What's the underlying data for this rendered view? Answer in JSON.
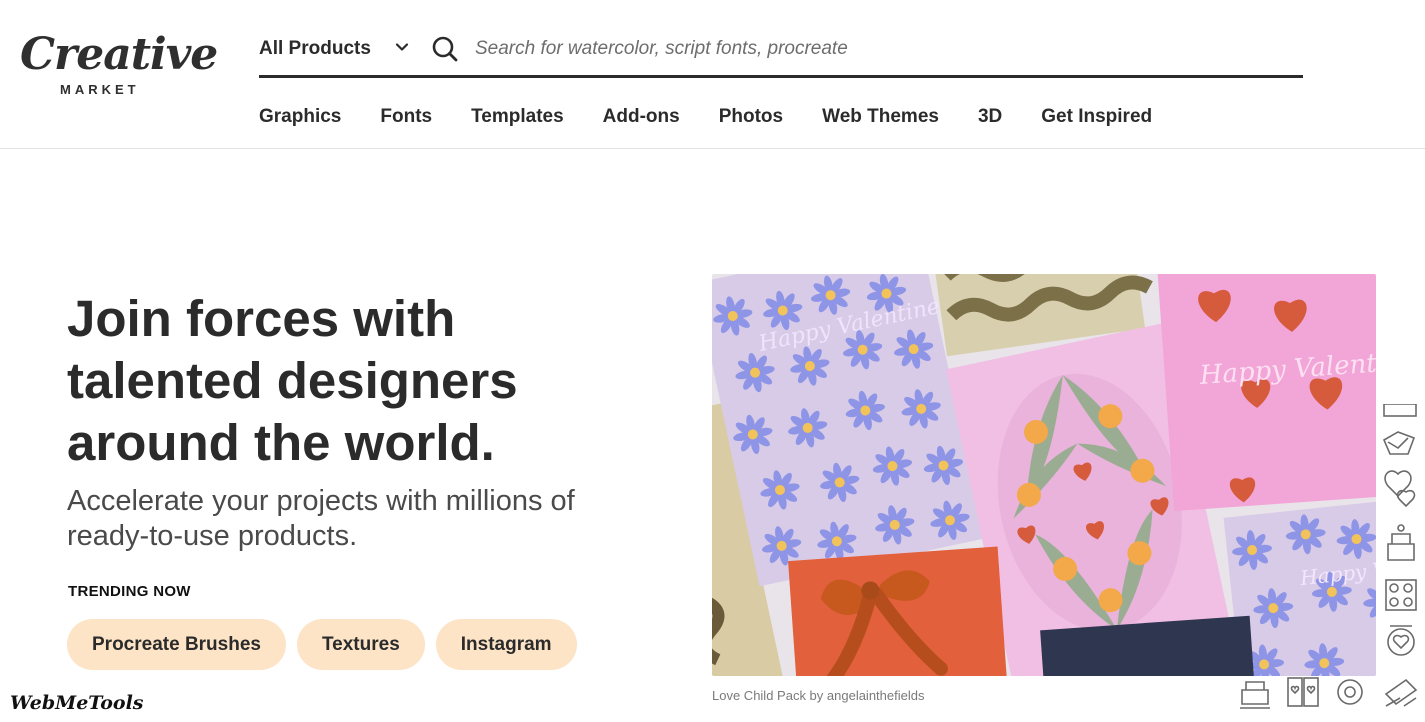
{
  "header": {
    "logo": {
      "script": "Creative",
      "sub": "MARKET"
    },
    "search": {
      "category_label": "All Products",
      "placeholder": "Search for watercolor, script fonts, procreate",
      "value": ""
    },
    "nav": [
      "Graphics",
      "Fonts",
      "Templates",
      "Add-ons",
      "Photos",
      "Web Themes",
      "3D",
      "Get Inspired"
    ]
  },
  "hero": {
    "title": "Join forces with talented designers around the world.",
    "subtitle": "Accelerate your projects with millions of ready-to-use products.",
    "trending_label": "TRENDING NOW",
    "trending": [
      "Procreate Brushes",
      "Textures",
      "Instagram"
    ],
    "image_caption": "Love Child Pack by angelainthefields",
    "card_texts": {
      "happy_valentines": "Happy Valentines"
    }
  },
  "watermark": "WebMeTools",
  "colors": {
    "pill_bg": "#fde4c7",
    "text": "#2b2b2b",
    "card_pink": "#f2a4d6",
    "card_lavender": "#d9c9e8",
    "card_red": "#e1623f",
    "card_navy": "#2e3549"
  },
  "icons": [
    "chevron-down-icon",
    "search-icon"
  ]
}
